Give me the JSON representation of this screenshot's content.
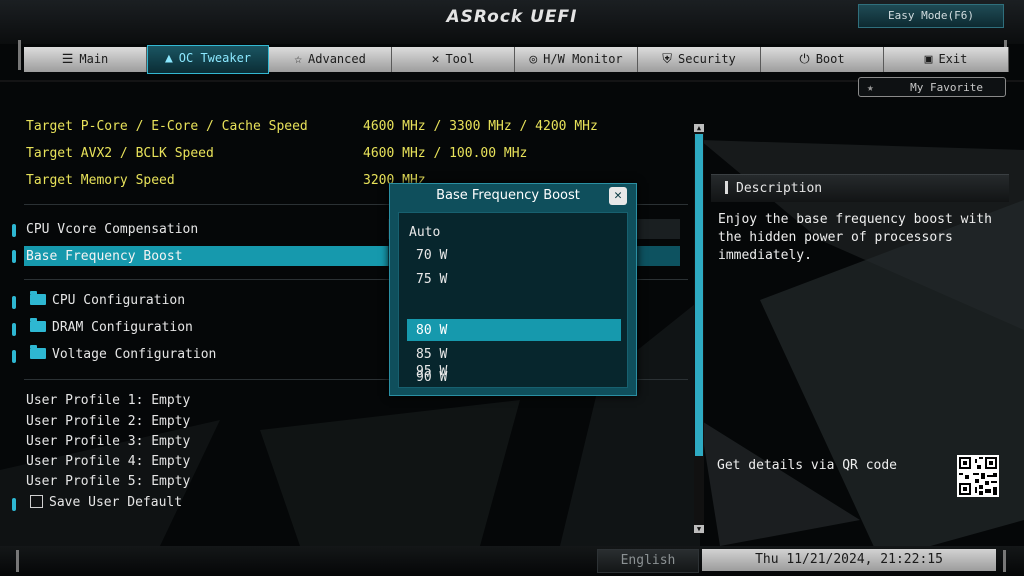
{
  "header": {
    "brand": "ASRock UEFI",
    "easy_mode_label": "Easy Mode(F6)"
  },
  "tabs": [
    {
      "label": "Main",
      "icon": "list-icon",
      "active": false
    },
    {
      "label": "OC Tweaker",
      "icon": "rocket-icon",
      "active": true
    },
    {
      "label": "Advanced",
      "icon": "star-icon",
      "active": false
    },
    {
      "label": "Tool",
      "icon": "wrench-icon",
      "active": false
    },
    {
      "label": "H/W Monitor",
      "icon": "globe-icon",
      "active": false
    },
    {
      "label": "Security",
      "icon": "shield-icon",
      "active": false
    },
    {
      "label": "Boot",
      "icon": "power-icon",
      "active": false
    },
    {
      "label": "Exit",
      "icon": "exit-door-icon",
      "active": false
    }
  ],
  "my_favorite_label": "My Favorite",
  "info_rows": [
    {
      "label": "Target P-Core / E-Core / Cache Speed",
      "value": "4600 MHz / 3300 MHz / 4200 MHz"
    },
    {
      "label": "Target AVX2 / BCLK Speed",
      "value": "4600 MHz / 100.00 MHz"
    },
    {
      "label": "Target Memory Speed",
      "value": "3200 MHz"
    }
  ],
  "settings": [
    {
      "label": "CPU Vcore Compensation"
    },
    {
      "label": "Base Frequency Boost"
    }
  ],
  "folders": [
    {
      "label": "CPU Configuration"
    },
    {
      "label": "DRAM Configuration"
    },
    {
      "label": "Voltage Configuration"
    }
  ],
  "profiles": [
    "User Profile 1: Empty",
    "User Profile 2: Empty",
    "User Profile 3: Empty",
    "User Profile 4: Empty",
    "User Profile 5: Empty"
  ],
  "save_user_default": "Save User Default",
  "popup": {
    "title": "Base Frequency Boost",
    "close_icon": "close-icon",
    "options": [
      "Auto",
      "70 W",
      "75 W",
      "80 W",
      "85 W",
      "90 W",
      "95 W"
    ],
    "selected": "80 W"
  },
  "description": {
    "title": "Description",
    "text": "Enjoy the base frequency boost with the hidden power of processors immediately.",
    "qr_label": "Get details via QR code"
  },
  "footer": {
    "language": "English",
    "datetime": "Thu 11/21/2024, 21:22:15"
  },
  "colors": {
    "accent": "#1699ad",
    "highlight_text": "#e8e25a",
    "popup_bg": "#0f4f5c"
  }
}
